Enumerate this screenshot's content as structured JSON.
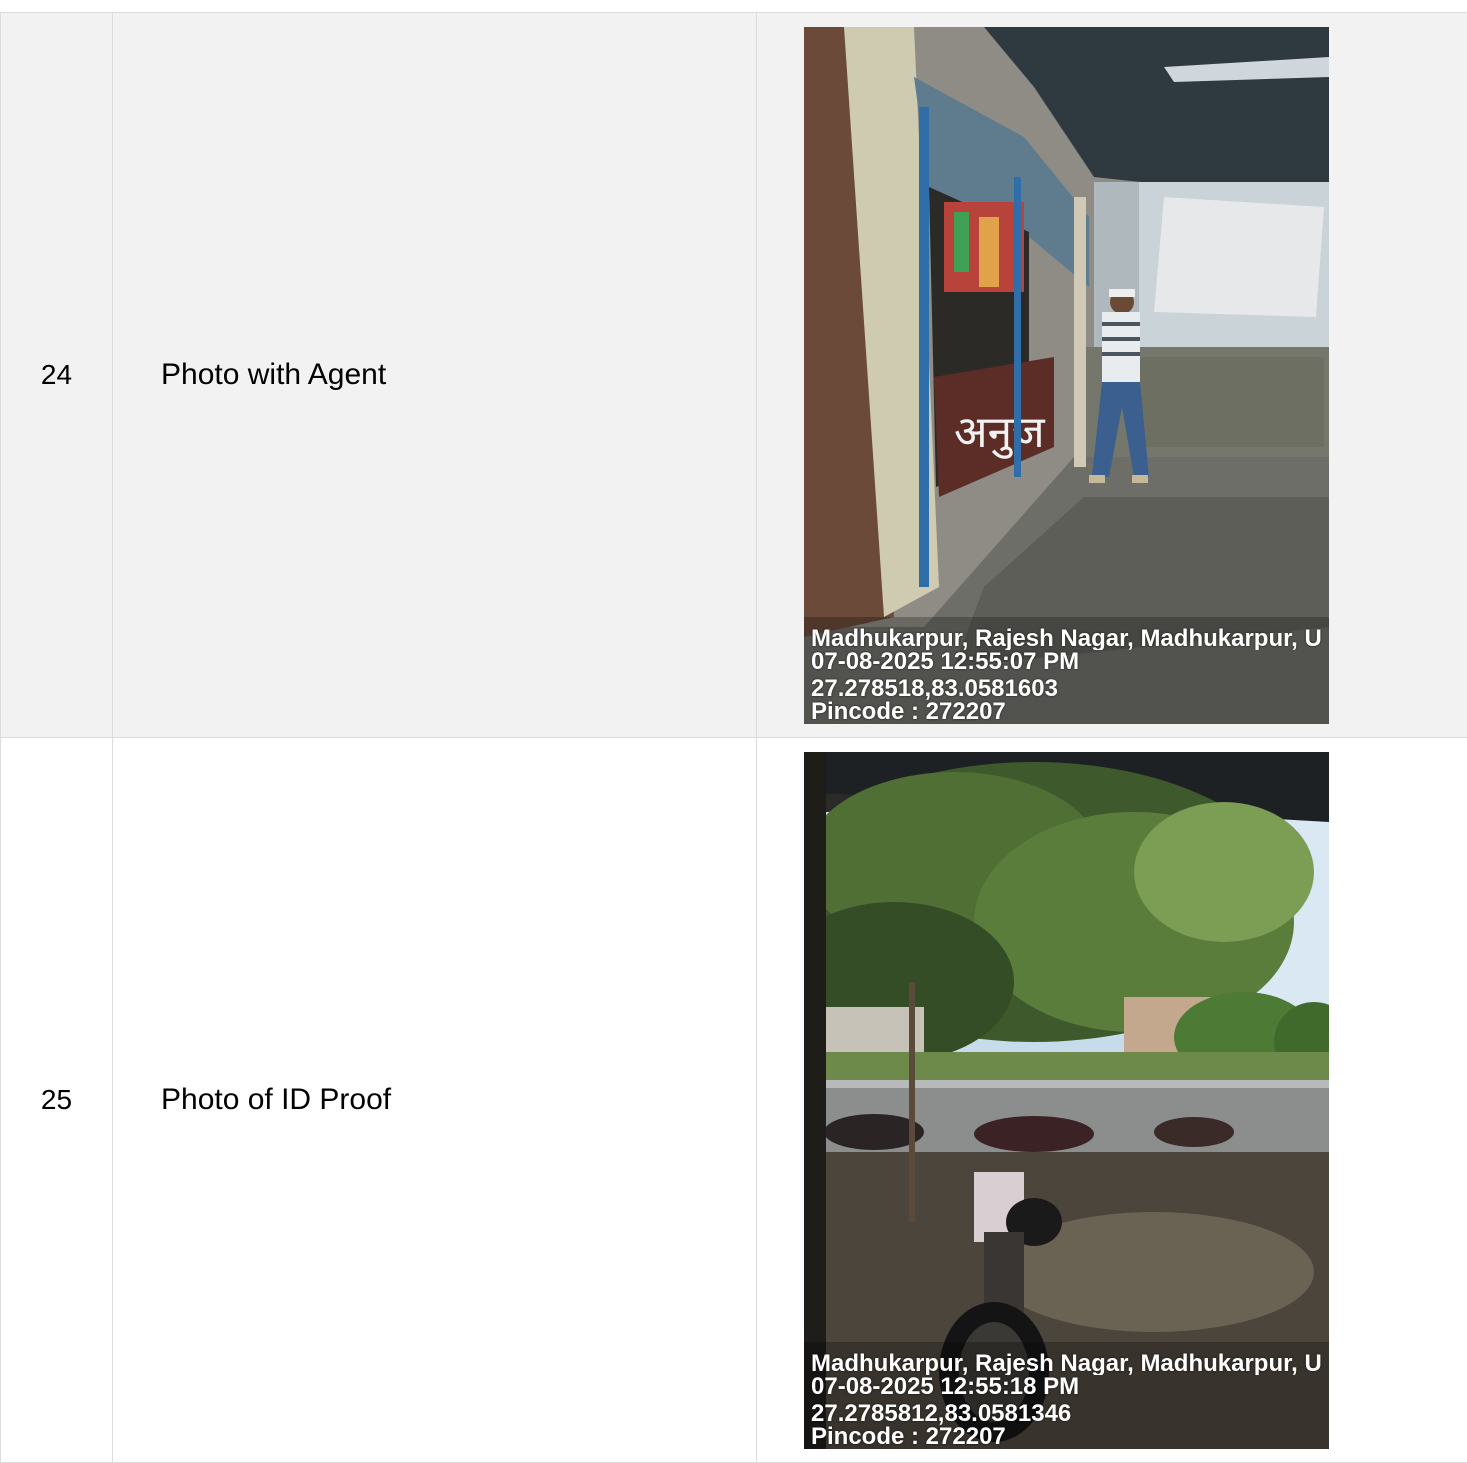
{
  "rows": [
    {
      "number": "24",
      "label": "Photo with Agent",
      "stamp": {
        "address": "Madhukarpur, Rajesh Nagar, Madhukarpur, U",
        "datetime": "07-08-2025 12:55:07 PM",
        "coords": "27.278518,83.0581603",
        "pincode": "Pincode : 272207"
      },
      "shop_sign": "अनुज"
    },
    {
      "number": "25",
      "label": "Photo of ID Proof",
      "stamp": {
        "address": "Madhukarpur, Rajesh Nagar, Madhukarpur, U",
        "datetime": "07-08-2025 12:55:18 PM",
        "coords": "27.2785812,83.0581346",
        "pincode": "Pincode : 272207"
      }
    }
  ]
}
